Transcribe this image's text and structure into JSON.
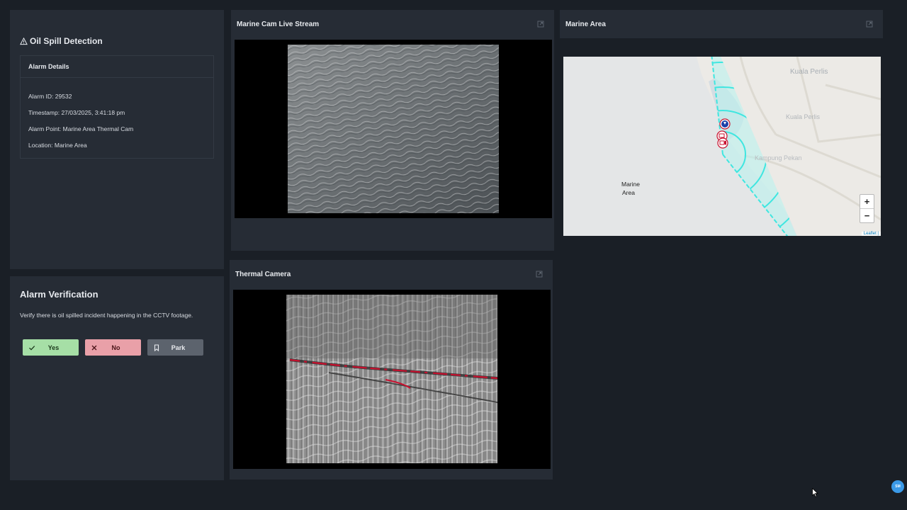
{
  "oil_spill": {
    "title": "Oil Spill Detection",
    "details_header": "Alarm Details",
    "alarm_id": "Alarm ID: 29532",
    "timestamp": "Timestamp: 27/03/2025, 3:41:18 pm",
    "alarm_point": "Alarm Point: Marine Area Thermal Cam",
    "location": "Location: Marine Area"
  },
  "verification": {
    "title": "Alarm Verification",
    "description": "Verify there is oil spilled incident happening in the CCTV footage.",
    "yes_label": "Yes",
    "no_label": "No",
    "park_label": "Park"
  },
  "panels": {
    "marine_cam": "Marine Cam Live Stream",
    "marine_area": "Marine Area",
    "thermal_cam": "Thermal Camera"
  },
  "map": {
    "labels": {
      "kuala_perlis_1": "Kuala Perlis",
      "kuala_perlis_2": "Kuala Perlis",
      "kampung": "Kampung Pekan",
      "marine_area_1": "Marine",
      "marine_area_2": "Area"
    },
    "zoom_in": "+",
    "zoom_out": "−",
    "attribution": "Leaflet |"
  },
  "fab_label": "SM",
  "colors": {
    "background": "#1a1f26",
    "panel": "#262c35",
    "yes": "#a6dfa6",
    "no": "#e9a0a8",
    "park": "#5c636d",
    "radar": "#3fe6e0"
  }
}
